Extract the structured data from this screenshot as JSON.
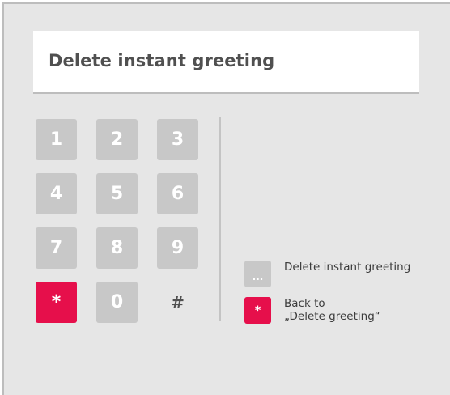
{
  "title": "Delete instant greeting",
  "keypad": {
    "k1": "1",
    "k2": "2",
    "k3": "3",
    "k4": "4",
    "k5": "5",
    "k6": "6",
    "k7": "7",
    "k8": "8",
    "k9": "9",
    "kstar": "*",
    "k0": "0",
    "khash": "#"
  },
  "legend": {
    "item1": {
      "badge": "...",
      "label": "Delete instant greeting"
    },
    "item2": {
      "badge": "*",
      "line1": "Back to",
      "line2": "„Delete greeting“"
    }
  },
  "colors": {
    "background": "#e6e6e6",
    "key_inactive": "#c8c8c8",
    "key_accent": "#e60f4b",
    "title_text": "#505050"
  }
}
